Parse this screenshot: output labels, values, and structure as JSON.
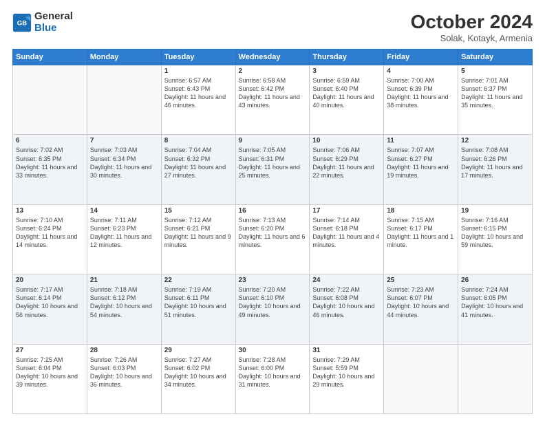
{
  "header": {
    "logo_line1": "General",
    "logo_line2": "Blue",
    "month": "October 2024",
    "location": "Solak, Kotayk, Armenia"
  },
  "weekdays": [
    "Sunday",
    "Monday",
    "Tuesday",
    "Wednesday",
    "Thursday",
    "Friday",
    "Saturday"
  ],
  "weeks": [
    [
      {
        "day": "",
        "info": ""
      },
      {
        "day": "",
        "info": ""
      },
      {
        "day": "1",
        "info": "Sunrise: 6:57 AM\nSunset: 6:43 PM\nDaylight: 11 hours and 46 minutes."
      },
      {
        "day": "2",
        "info": "Sunrise: 6:58 AM\nSunset: 6:42 PM\nDaylight: 11 hours and 43 minutes."
      },
      {
        "day": "3",
        "info": "Sunrise: 6:59 AM\nSunset: 6:40 PM\nDaylight: 11 hours and 40 minutes."
      },
      {
        "day": "4",
        "info": "Sunrise: 7:00 AM\nSunset: 6:39 PM\nDaylight: 11 hours and 38 minutes."
      },
      {
        "day": "5",
        "info": "Sunrise: 7:01 AM\nSunset: 6:37 PM\nDaylight: 11 hours and 35 minutes."
      }
    ],
    [
      {
        "day": "6",
        "info": "Sunrise: 7:02 AM\nSunset: 6:35 PM\nDaylight: 11 hours and 33 minutes."
      },
      {
        "day": "7",
        "info": "Sunrise: 7:03 AM\nSunset: 6:34 PM\nDaylight: 11 hours and 30 minutes."
      },
      {
        "day": "8",
        "info": "Sunrise: 7:04 AM\nSunset: 6:32 PM\nDaylight: 11 hours and 27 minutes."
      },
      {
        "day": "9",
        "info": "Sunrise: 7:05 AM\nSunset: 6:31 PM\nDaylight: 11 hours and 25 minutes."
      },
      {
        "day": "10",
        "info": "Sunrise: 7:06 AM\nSunset: 6:29 PM\nDaylight: 11 hours and 22 minutes."
      },
      {
        "day": "11",
        "info": "Sunrise: 7:07 AM\nSunset: 6:27 PM\nDaylight: 11 hours and 19 minutes."
      },
      {
        "day": "12",
        "info": "Sunrise: 7:08 AM\nSunset: 6:26 PM\nDaylight: 11 hours and 17 minutes."
      }
    ],
    [
      {
        "day": "13",
        "info": "Sunrise: 7:10 AM\nSunset: 6:24 PM\nDaylight: 11 hours and 14 minutes."
      },
      {
        "day": "14",
        "info": "Sunrise: 7:11 AM\nSunset: 6:23 PM\nDaylight: 11 hours and 12 minutes."
      },
      {
        "day": "15",
        "info": "Sunrise: 7:12 AM\nSunset: 6:21 PM\nDaylight: 11 hours and 9 minutes."
      },
      {
        "day": "16",
        "info": "Sunrise: 7:13 AM\nSunset: 6:20 PM\nDaylight: 11 hours and 6 minutes."
      },
      {
        "day": "17",
        "info": "Sunrise: 7:14 AM\nSunset: 6:18 PM\nDaylight: 11 hours and 4 minutes."
      },
      {
        "day": "18",
        "info": "Sunrise: 7:15 AM\nSunset: 6:17 PM\nDaylight: 11 hours and 1 minute."
      },
      {
        "day": "19",
        "info": "Sunrise: 7:16 AM\nSunset: 6:15 PM\nDaylight: 10 hours and 59 minutes."
      }
    ],
    [
      {
        "day": "20",
        "info": "Sunrise: 7:17 AM\nSunset: 6:14 PM\nDaylight: 10 hours and 56 minutes."
      },
      {
        "day": "21",
        "info": "Sunrise: 7:18 AM\nSunset: 6:12 PM\nDaylight: 10 hours and 54 minutes."
      },
      {
        "day": "22",
        "info": "Sunrise: 7:19 AM\nSunset: 6:11 PM\nDaylight: 10 hours and 51 minutes."
      },
      {
        "day": "23",
        "info": "Sunrise: 7:20 AM\nSunset: 6:10 PM\nDaylight: 10 hours and 49 minutes."
      },
      {
        "day": "24",
        "info": "Sunrise: 7:22 AM\nSunset: 6:08 PM\nDaylight: 10 hours and 46 minutes."
      },
      {
        "day": "25",
        "info": "Sunrise: 7:23 AM\nSunset: 6:07 PM\nDaylight: 10 hours and 44 minutes."
      },
      {
        "day": "26",
        "info": "Sunrise: 7:24 AM\nSunset: 6:05 PM\nDaylight: 10 hours and 41 minutes."
      }
    ],
    [
      {
        "day": "27",
        "info": "Sunrise: 7:25 AM\nSunset: 6:04 PM\nDaylight: 10 hours and 39 minutes."
      },
      {
        "day": "28",
        "info": "Sunrise: 7:26 AM\nSunset: 6:03 PM\nDaylight: 10 hours and 36 minutes."
      },
      {
        "day": "29",
        "info": "Sunrise: 7:27 AM\nSunset: 6:02 PM\nDaylight: 10 hours and 34 minutes."
      },
      {
        "day": "30",
        "info": "Sunrise: 7:28 AM\nSunset: 6:00 PM\nDaylight: 10 hours and 31 minutes."
      },
      {
        "day": "31",
        "info": "Sunrise: 7:29 AM\nSunset: 5:59 PM\nDaylight: 10 hours and 29 minutes."
      },
      {
        "day": "",
        "info": ""
      },
      {
        "day": "",
        "info": ""
      }
    ]
  ]
}
